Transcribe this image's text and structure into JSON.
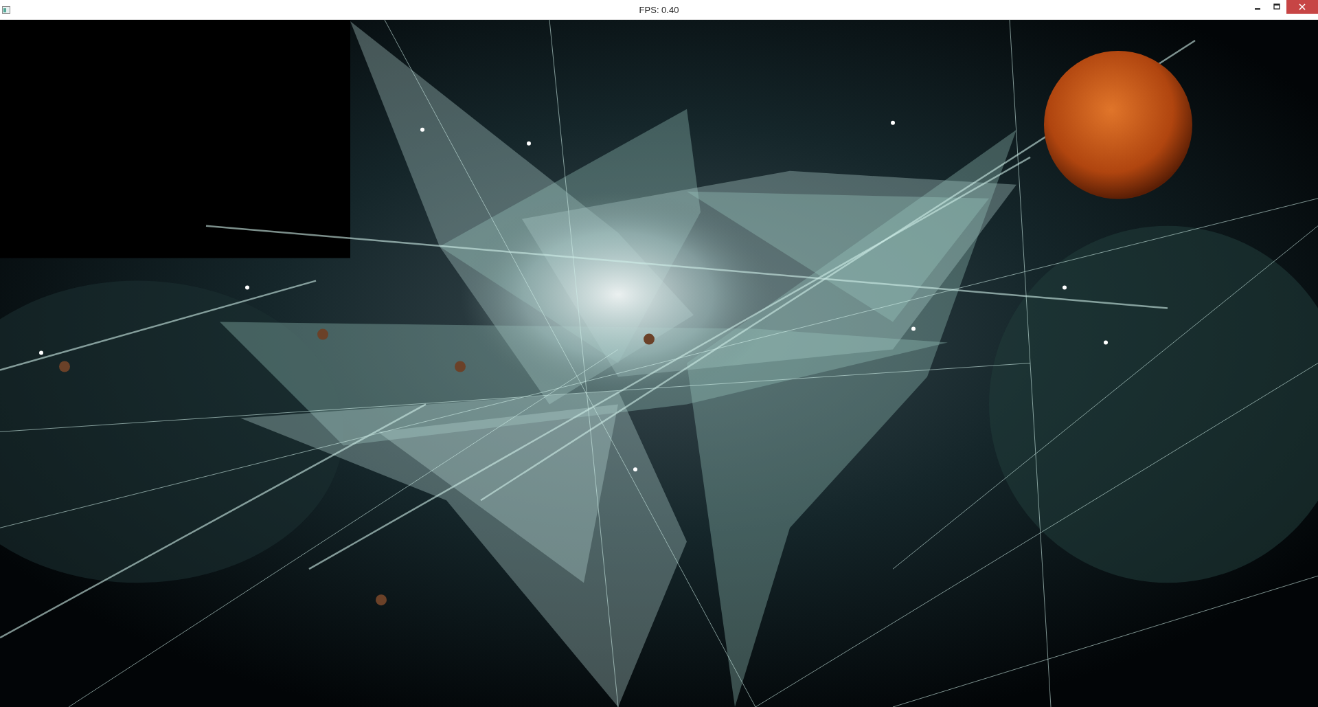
{
  "window": {
    "title": "FPS: 0.40"
  }
}
